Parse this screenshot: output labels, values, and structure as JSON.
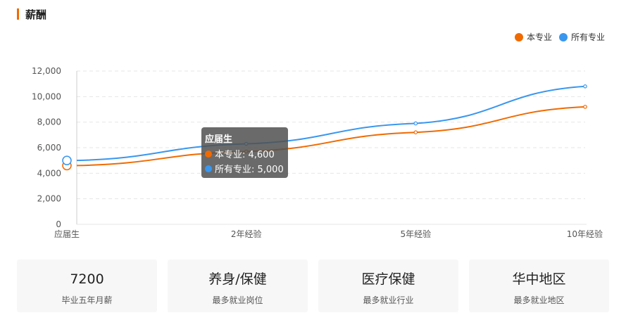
{
  "section": {
    "title": "薪酬"
  },
  "colors": {
    "accent": "#f06a00",
    "major": "#f06a00",
    "all": "#3a97ee"
  },
  "chart_data": {
    "type": "line",
    "categories": [
      "应届生",
      "2年经验",
      "5年经验",
      "10年经验"
    ],
    "series": [
      {
        "name": "本专业",
        "values": [
          4600,
          5700,
          7200,
          9200
        ],
        "color": "#f06a00"
      },
      {
        "name": "所有专业",
        "values": [
          5000,
          6300,
          7900,
          10800
        ],
        "color": "#3a97ee"
      }
    ],
    "ylim": [
      0,
      12000
    ],
    "yticks": [
      "0",
      "2,000",
      "4,000",
      "6,000",
      "8,000",
      "10,000",
      "12,000"
    ],
    "grid": true,
    "legend": "top-right"
  },
  "tooltip": {
    "title": "应届生",
    "rows": [
      {
        "text": "本专业: 4,600",
        "color": "#f06a00"
      },
      {
        "text": "所有专业: 5,000",
        "color": "#3a97ee"
      }
    ]
  },
  "cards": [
    {
      "value": "7200",
      "label": "毕业五年月薪"
    },
    {
      "value": "养身/保健",
      "label": "最多就业岗位"
    },
    {
      "value": "医疗保健",
      "label": "最多就业行业"
    },
    {
      "value": "华中地区",
      "label": "最多就业地区"
    }
  ]
}
